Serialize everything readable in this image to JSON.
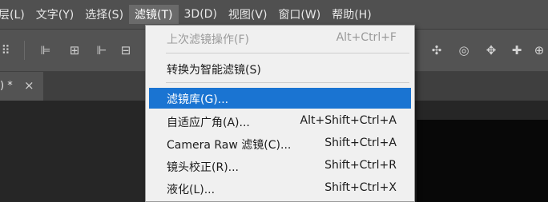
{
  "menubar": {
    "items": [
      {
        "label": "层(L)"
      },
      {
        "label": "文字(Y)"
      },
      {
        "label": "选择(S)"
      },
      {
        "label": "滤镜(T)"
      },
      {
        "label": "3D(D)"
      },
      {
        "label": "视图(V)"
      },
      {
        "label": "窗口(W)"
      },
      {
        "label": "帮助(H)"
      }
    ]
  },
  "document_tab": {
    "label": ") *",
    "close": "×"
  },
  "filter_menu": {
    "items": [
      {
        "label": "上次滤镜操作(F)",
        "shortcut": "Alt+Ctrl+F",
        "disabled": true
      },
      {
        "label": "转换为智能滤镜(S)",
        "shortcut": ""
      },
      {
        "label": "滤镜库(G)...",
        "shortcut": "",
        "selected": true
      },
      {
        "label": "自适应广角(A)...",
        "shortcut": "Alt+Shift+Ctrl+A"
      },
      {
        "label": "Camera Raw 滤镜(C)...",
        "shortcut": "Shift+Ctrl+A"
      },
      {
        "label": "镜头校正(R)...",
        "shortcut": "Shift+Ctrl+R"
      },
      {
        "label": "液化(L)...",
        "shortcut": "Shift+Ctrl+X"
      }
    ]
  },
  "colors": {
    "menu_highlight": "#1a74d2",
    "menu_background": "#f0f0f0",
    "app_chrome": "#535353",
    "workspace": "#262626"
  },
  "icons": {
    "options_left": "align-left-edges-icon",
    "options_center": "align-horizontal-centers-icon",
    "options_right": "align-right-edges-icon",
    "options_3d_orbit": "3d-orbit-icon",
    "options_3d_roll": "3d-roll-icon",
    "options_3d_pan": "3d-pan-icon",
    "options_3d_move": "3d-move-icon"
  }
}
